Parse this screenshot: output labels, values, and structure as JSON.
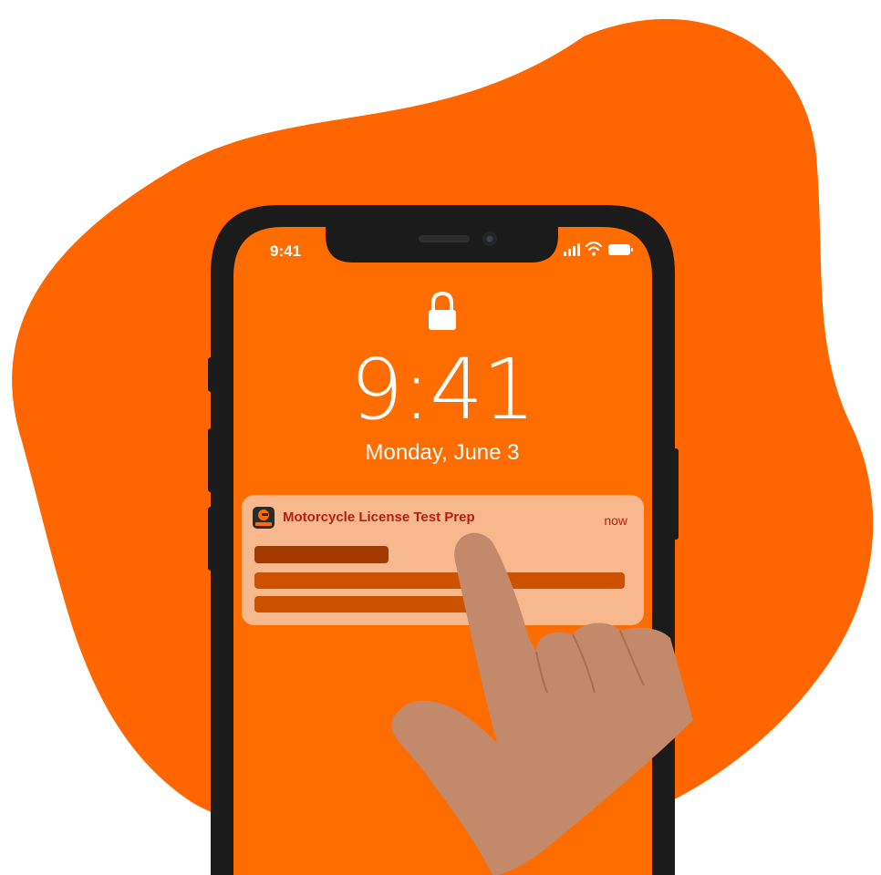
{
  "status_bar": {
    "time": "9:41",
    "icons": [
      "signal-icon",
      "wifi-icon",
      "battery-icon"
    ]
  },
  "lock_screen": {
    "lock_icon": "lock-icon",
    "time": "9:41",
    "date": "Monday, June 3"
  },
  "notification": {
    "app_icon": "moto-app-icon",
    "app_name": "Motorcycle License Test Prep",
    "time": "now"
  },
  "colors": {
    "blob": "#ff6600",
    "screen": "#ff6c00",
    "phone_frame": "#1b1b1b",
    "notification_bg": "#f8b88e",
    "notification_title": "#b81e10",
    "placeholder_dark": "#a33a00",
    "placeholder": "#cc5200",
    "hand": "#c2896a"
  }
}
